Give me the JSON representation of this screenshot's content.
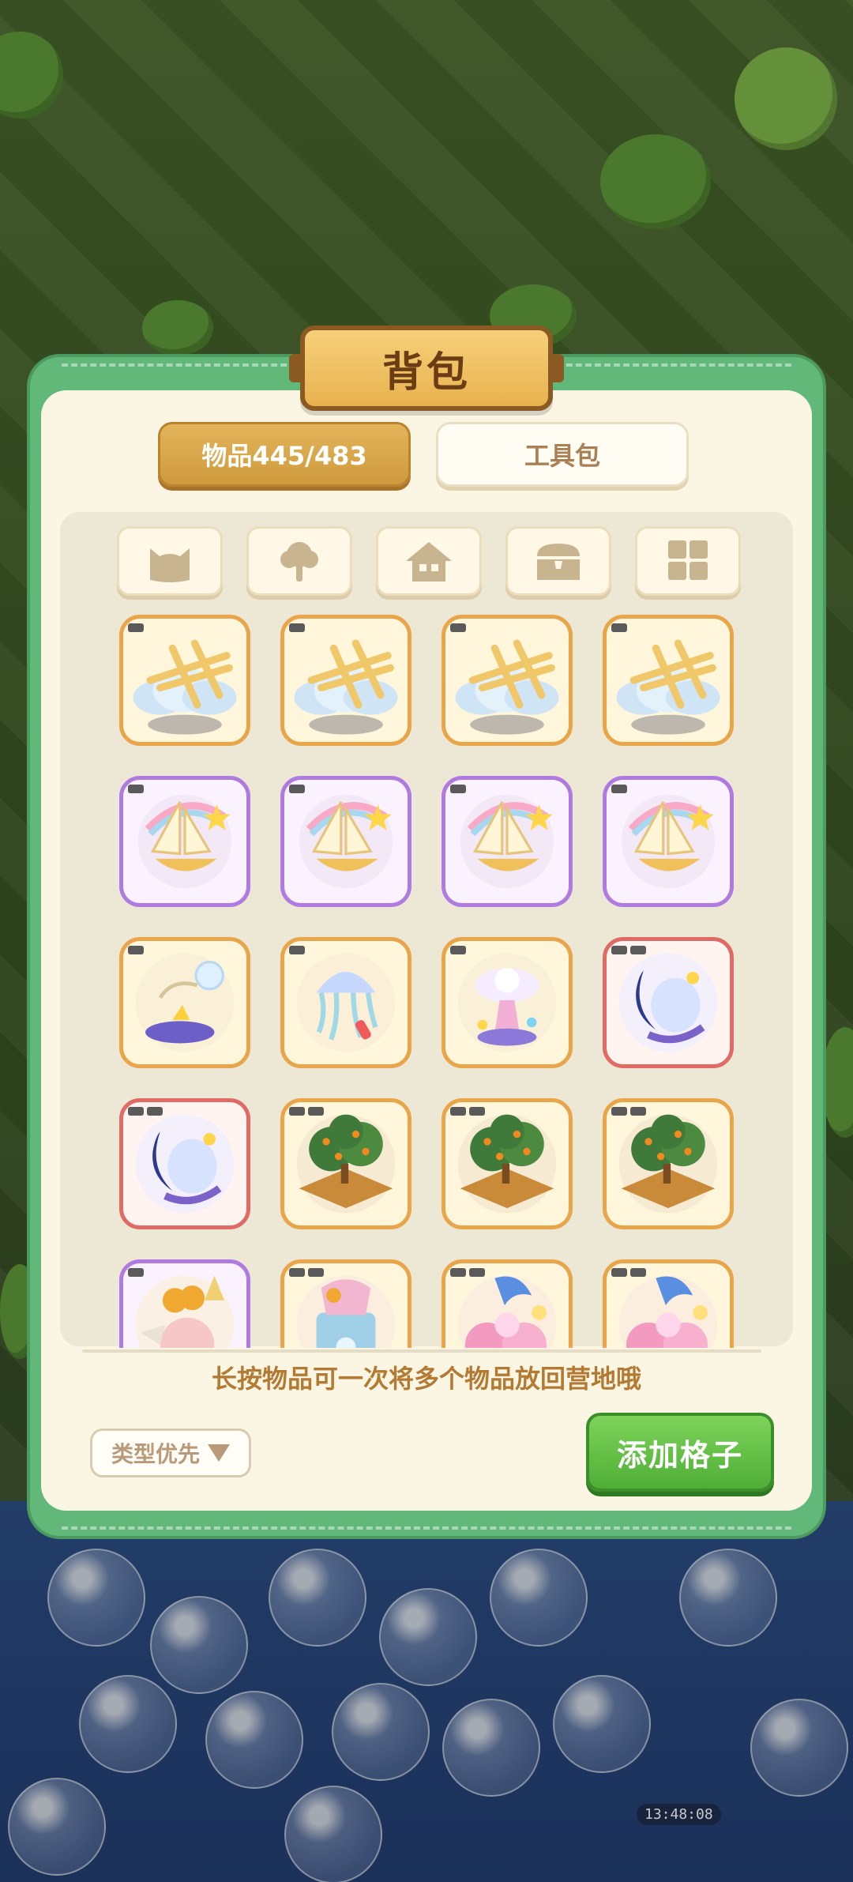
{
  "panel": {
    "title": "背包",
    "tabs": [
      {
        "label": "物品445/483",
        "active": true
      },
      {
        "label": "工具包",
        "active": false
      }
    ],
    "categories": [
      {
        "icon": "cat-icon"
      },
      {
        "icon": "tree-icon"
      },
      {
        "icon": "house-icon"
      },
      {
        "icon": "chest-icon"
      },
      {
        "icon": "grid-icon"
      }
    ],
    "items": [
      {
        "icon": "cloud-gate-icon",
        "rarity": "gold",
        "tags": 1
      },
      {
        "icon": "cloud-gate-icon",
        "rarity": "gold",
        "tags": 1
      },
      {
        "icon": "cloud-gate-icon",
        "rarity": "gold",
        "tags": 1
      },
      {
        "icon": "cloud-gate-icon",
        "rarity": "gold",
        "tags": 1
      },
      {
        "icon": "rainbow-sailboat-icon",
        "rarity": "purple",
        "tags": 1
      },
      {
        "icon": "rainbow-sailboat-icon",
        "rarity": "purple",
        "tags": 1
      },
      {
        "icon": "rainbow-sailboat-icon",
        "rarity": "purple",
        "tags": 1
      },
      {
        "icon": "rainbow-sailboat-icon",
        "rarity": "purple",
        "tags": 1
      },
      {
        "icon": "bubble-puddle-icon",
        "rarity": "gold",
        "tags": 1
      },
      {
        "icon": "jellyfish-lamp-icon",
        "rarity": "gold",
        "tags": 1
      },
      {
        "icon": "cat-cloud-fountain-icon",
        "rarity": "gold",
        "tags": 1
      },
      {
        "icon": "moon-dream-icon",
        "rarity": "red",
        "tags": 2
      },
      {
        "icon": "moon-dream-icon",
        "rarity": "red",
        "tags": 2
      },
      {
        "icon": "orange-tree-plot-icon",
        "rarity": "gold",
        "tags": 2
      },
      {
        "icon": "orange-tree-plot-icon",
        "rarity": "gold",
        "tags": 2
      },
      {
        "icon": "orange-tree-plot-icon",
        "rarity": "gold",
        "tags": 4
      },
      {
        "icon": "duck-carousel-icon",
        "rarity": "purple",
        "tags": 1
      },
      {
        "icon": "fairy-castle-icon",
        "rarity": "gold",
        "tags": 2
      },
      {
        "icon": "pink-castle-icon",
        "rarity": "gold",
        "tags": 2
      },
      {
        "icon": "pink-castle-icon",
        "rarity": "gold",
        "tags": 2
      }
    ],
    "hint": "长按物品可一次将多个物品放回营地哦",
    "sort_label": "类型优先",
    "add_label": "添加格子",
    "colors": {
      "frame": "#62b879",
      "inner": "#fbf6e4",
      "gold_border": "#e9a54a",
      "purple_border": "#b07be0",
      "red_border": "#e06a64",
      "accent_button": "#4fae36"
    }
  },
  "world": {
    "timer": "13:48:08"
  }
}
